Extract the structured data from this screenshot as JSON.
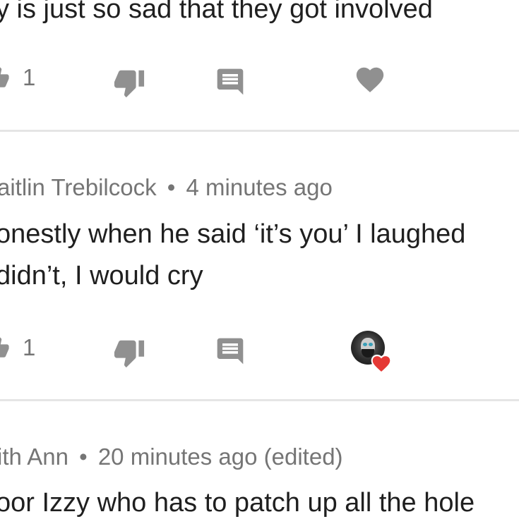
{
  "comments": [
    {
      "text_lines": [
        "y is just so sad that they got involved"
      ],
      "like_count": "1"
    },
    {
      "author": "aitlin Trebilcock",
      "separator": "•",
      "time": "4 minutes ago",
      "text_lines": [
        "onestly when he said ‘it’s you’ I laughed",
        "didn’t, I would cry"
      ],
      "like_count": "1"
    },
    {
      "author": "ith Ann",
      "separator": "•",
      "time": "20 minutes ago (edited)",
      "text_lines": [
        "oor Izzy who has to patch up all the hole"
      ]
    }
  ],
  "icons": {
    "like": "thumbs-up-icon",
    "dislike": "thumbs-down-icon",
    "reply": "reply-comment-icon",
    "heart": "heart-icon",
    "creator_heart": "creator-heart-avatar-icon"
  },
  "colors": {
    "icon_gray": "#909090",
    "heart_red": "#e53935",
    "meta_gray": "#757575",
    "divider": "#e5e5e5"
  }
}
